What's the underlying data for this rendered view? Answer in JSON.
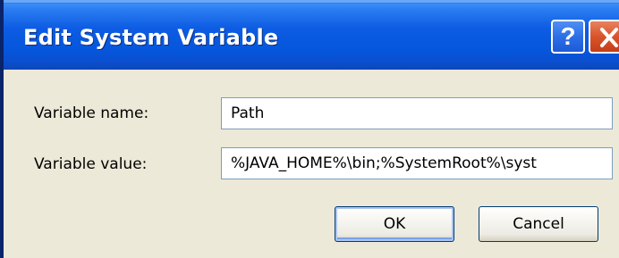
{
  "dialog": {
    "title": "Edit System Variable",
    "help_button": "?",
    "close_icon": "close-icon"
  },
  "form": {
    "name_label": "Variable name:",
    "name_value": "Path",
    "value_label": "Variable value:",
    "value_value": "%JAVA_HOME%\\bin;%SystemRoot%\\syst"
  },
  "buttons": {
    "ok_label": "OK",
    "cancel_label": "Cancel"
  },
  "colors": {
    "titlebar": "#0a5fe6",
    "close_button": "#d9542b",
    "dialog_background": "#ece9d8"
  }
}
